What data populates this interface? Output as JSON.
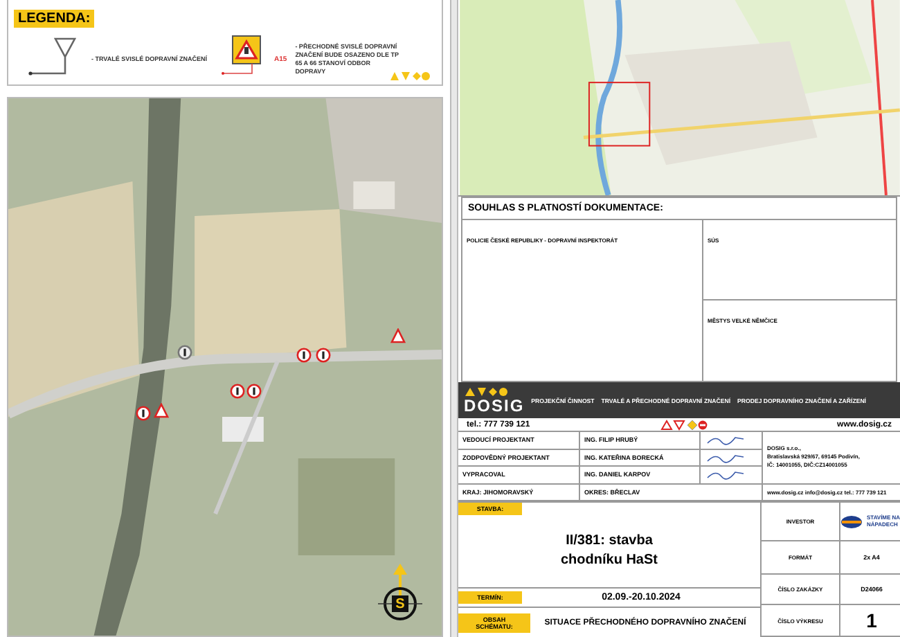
{
  "legend": {
    "title": "LEGENDA:",
    "items": [
      {
        "kind": "permanent",
        "text": "- TRVALÉ SVISLÉ DOPRAVNÍ ZNAČENÍ"
      },
      {
        "kind": "temporary",
        "code": "A15",
        "text": "- PŘECHODNÉ SVISLÉ DOPRAVNÍ ZNAČENÍ BUDE OSAZENO DLE TP 65 A 66 STANOVÍ ODBOR DOPRAVY"
      }
    ]
  },
  "consent": {
    "title": "SOUHLAS S PLATNOSTÍ DOKUMENTACE:",
    "boxes": [
      {
        "label": "POLICIE ČESKÉ REPUBLIKY - DOPRAVNÍ INSPEKTORÁT"
      },
      {
        "label": "SÚS"
      },
      {
        "label": "MĚSTYS VELKÉ NĚMČICE"
      }
    ]
  },
  "company": {
    "logo": "DOSIG",
    "services": [
      "PROJEKČNÍ ČINNOST",
      "TRVALÉ A PŘECHODNÉ DOPRAVNÍ ZNAČENÍ",
      "PRODEJ DOPRAVNÍHO ZNAČENÍ A ZAŘÍZENÍ"
    ],
    "phone": "tel.: 777 739 121",
    "web": "www.dosig.cz"
  },
  "people": [
    {
      "role": "VEDOUCÍ PROJEKTANT",
      "name": "ING. FILIP HRUBÝ"
    },
    {
      "role": "ZODPOVĚDNÝ PROJEKTANT",
      "name": "ING. KATEŘINA BORECKÁ"
    },
    {
      "role": "VYPRACOVAL",
      "name": "ING. DANIEL KARPOV"
    }
  ],
  "region": "KRAJ: JIHOMORAVSKÝ",
  "district": "OKRES: BŘECLAV",
  "company_info": [
    "DOSIG s.r.o.,",
    "Bratislavská 929/67, 69145 Podivín,",
    "IČ: 14001055, DIČ:CZ14001055"
  ],
  "contacts": "www.dosig.cz info@dosig.cz tel.: 777 739 121",
  "project": {
    "stavba_label": "STAVBA:",
    "title_lines": [
      "II/381: stavba",
      "chodníku HaSt"
    ],
    "term_label": "TERMÍN:",
    "term": "02.09.-20.10.2024",
    "content_label": "OBSAH SCHÉMATU:",
    "content": "SITUACE PŘECHODNÉHO DOPRAVNÍHO ZNAČENÍ"
  },
  "meta": [
    {
      "kind": "logo",
      "label": "INVESTOR",
      "value": "STAVÍME NA NÁPADECH"
    },
    {
      "kind": "text",
      "label": "FORMÁT",
      "value": "2x A4"
    },
    {
      "kind": "text",
      "label": "ČÍSLO ZAKÁZKY",
      "value": "D24066"
    },
    {
      "kind": "big",
      "label": "ČÍSLO VÝKRESU",
      "value": "1"
    }
  ],
  "compass": {
    "letter": "S"
  }
}
